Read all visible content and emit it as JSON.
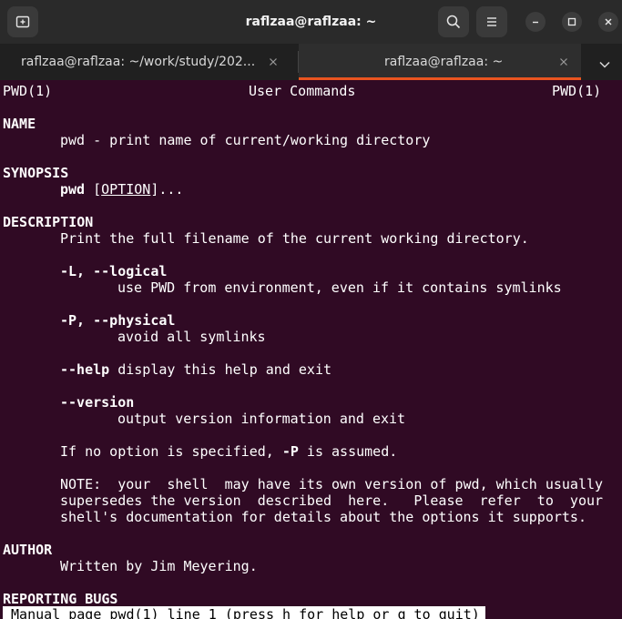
{
  "window": {
    "title": "raflzaa@raflzaa: ~"
  },
  "tabs": [
    {
      "label": "raflzaa@raflzaa: ~/work/study/202...",
      "active": false
    },
    {
      "label": "raflzaa@raflzaa: ~",
      "active": true
    }
  ],
  "icons": {
    "new_tab": "new-tab-icon",
    "search": "search-icon",
    "menu": "hamburger-menu-icon",
    "minimize": "minimize-icon",
    "maximize": "maximize-icon",
    "close": "close-icon",
    "tab_close": "close-icon",
    "tabs_menu": "chevron-down-icon"
  },
  "colors": {
    "terminal_bg": "#300a24",
    "accent": "#e95420",
    "titlebar_bg": "#2a2a2a"
  },
  "man": {
    "header_left": "PWD(1)",
    "header_center": "User Commands",
    "header_right": "PWD(1)",
    "name_heading": "NAME",
    "name_text": "pwd - print name of current/working directory",
    "synopsis_heading": "SYNOPSIS",
    "synopsis_cmd": "pwd",
    "synopsis_open": "[",
    "synopsis_option": "OPTION",
    "synopsis_rest": "]...",
    "description_heading": "DESCRIPTION",
    "description_text": "Print the full filename of the current working directory.",
    "opt_logical": "-L, --logical",
    "opt_logical_desc": "use PWD from environment, even if it contains symlinks",
    "opt_physical": "-P, --physical",
    "opt_physical_desc": "avoid all symlinks",
    "opt_help": "--help",
    "opt_help_desc": " display this help and exit",
    "opt_version": "--version",
    "opt_version_desc": "output version information and exit",
    "default_pre": "If no option is specified, ",
    "default_opt": "-P",
    "default_post": " is assumed.",
    "note_line1": "NOTE:  your  shell  may have its own version of pwd, which usually",
    "note_line2": "supersedes the version  described  here.   Please  refer  to  your",
    "note_line3": "shell's documentation for details about the options it supports.",
    "author_heading": "AUTHOR",
    "author_text": "Written by Jim Meyering.",
    "bugs_heading": "REPORTING BUGS"
  },
  "status_line": " Manual page pwd(1) line 1 (press h for help or q to quit)"
}
